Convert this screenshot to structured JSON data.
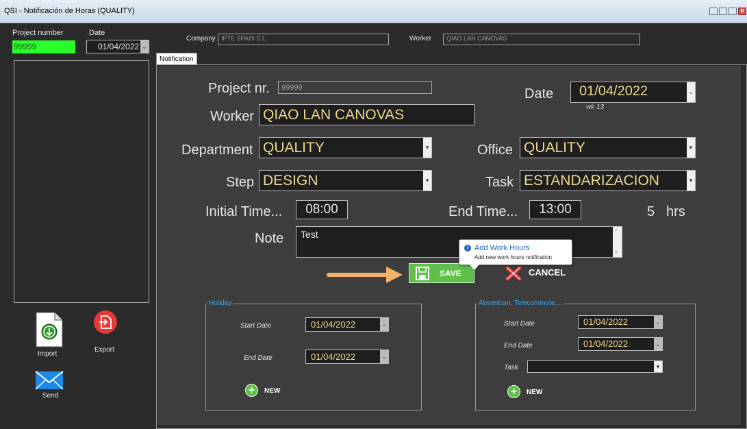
{
  "window": {
    "title": "QSI - Notificación de Horas (QUALITY)"
  },
  "left": {
    "project_label": "Project number",
    "project_value": "99999",
    "date_label": "Date",
    "date_value": "01/04/2022",
    "import_label": "Import",
    "export_label": "Export",
    "send_label": "Send"
  },
  "top": {
    "company_label": "Company",
    "company_value": "IPTE SPAIN S.L.",
    "worker_label": "Worker",
    "worker_value": "QIAO LAN CANOVAS"
  },
  "tab": {
    "label": "Notification"
  },
  "form": {
    "project_label": "Project nr.",
    "project_value": "99999",
    "date_label": "Date",
    "date_value": "01/04/2022",
    "week": "wk  13",
    "worker_label": "Worker",
    "worker_value": "QIAO LAN CANOVAS",
    "department_label": "Department",
    "department_value": "QUALITY",
    "office_label": "Office",
    "office_value": "QUALITY",
    "step_label": "Step",
    "step_value": "DESIGN",
    "task_label": "Task",
    "task_value": "ESTANDARIZACION",
    "initial_label": "Initial Time...",
    "initial_value": "08:00",
    "end_label": "End Time...",
    "end_value": "13:00",
    "hours_value": "5",
    "hours_unit": "hrs",
    "note_label": "Note",
    "note_value": "Test",
    "save_label": "SAVE",
    "cancel_label": "CANCEL"
  },
  "tooltip": {
    "title": "Add Work Hours",
    "text": "Add new work hours notification"
  },
  "holiday": {
    "title": "Holiday",
    "start_label": "Start Date",
    "start_value": "01/04/2022",
    "end_label": "End Date",
    "end_value": "01/04/2022",
    "new_label": "NEW"
  },
  "absentism": {
    "title": "Absentism, Telecommute....",
    "start_label": "Start Date",
    "start_value": "01/04/2022",
    "end_label": "End Date",
    "end_value": "01/04/2022",
    "task_label": "Task",
    "task_value": "",
    "new_label": "NEW"
  },
  "colors": {
    "accent_green": "#5fbf4a",
    "highlight_green": "#2bff2b",
    "label_yellow": "#f0d98c",
    "tooltip_blue": "#1e63b8"
  },
  "icons": [
    "import-icon",
    "export-icon",
    "send-icon",
    "save-icon",
    "cancel-icon",
    "info-icon",
    "add-icon",
    "arrow-icon"
  ]
}
